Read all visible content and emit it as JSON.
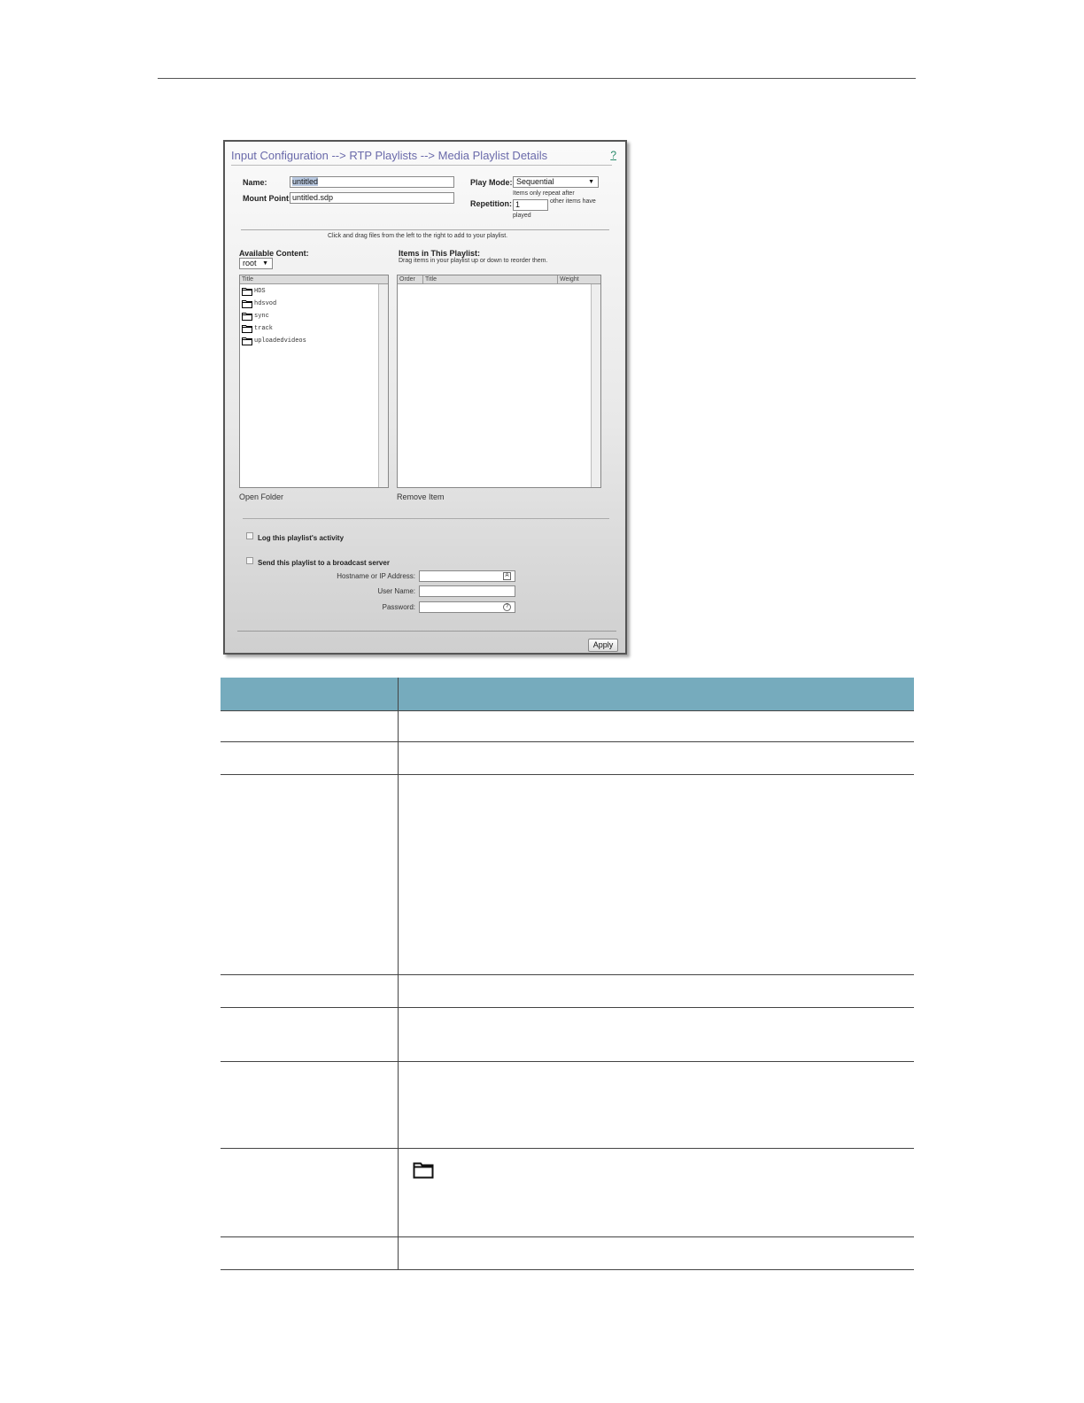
{
  "panel": {
    "title": "Input Configuration --> RTP Playlists --> Media Playlist Details",
    "help_link": "?",
    "name_label": "Name:",
    "name_value": "untitled",
    "mount_label": "Mount Point:",
    "mount_value": "untitled.sdp",
    "play_mode_label": "Play Mode:",
    "play_mode_value": "Sequential",
    "repetition_label": "Repetition:",
    "repetition_pre": "Items only repeat after",
    "repetition_value": "1",
    "repetition_post_1": "other items have",
    "repetition_post_2": "played",
    "drag_hint": "Click and drag files from the left to the right to add to your playlist.",
    "available_label": "Available Content:",
    "root_select": "root",
    "items_label": "Items in This Playlist:",
    "items_hint": "Drag items in your playlist up or down to reorder them.",
    "available_col_title": "Title",
    "folders": [
      "HDS",
      "hdsvod",
      "sync",
      "track",
      "uploadedvideos"
    ],
    "playlist_cols": [
      "Order",
      "Title",
      "Weight"
    ],
    "open_folder": "Open Folder",
    "remove_item": "Remove Item",
    "log_activity": "Log this playlist's activity",
    "send_broadcast": "Send this playlist to a broadcast server",
    "host_label": "Hostname or IP Address:",
    "user_label": "User Name:",
    "password_label": "Password:",
    "apply": "Apply",
    "host_icon": "A",
    "password_icon": "?"
  },
  "icons": {
    "folder": "folder-icon",
    "dropdown": "chevron-down-icon"
  }
}
